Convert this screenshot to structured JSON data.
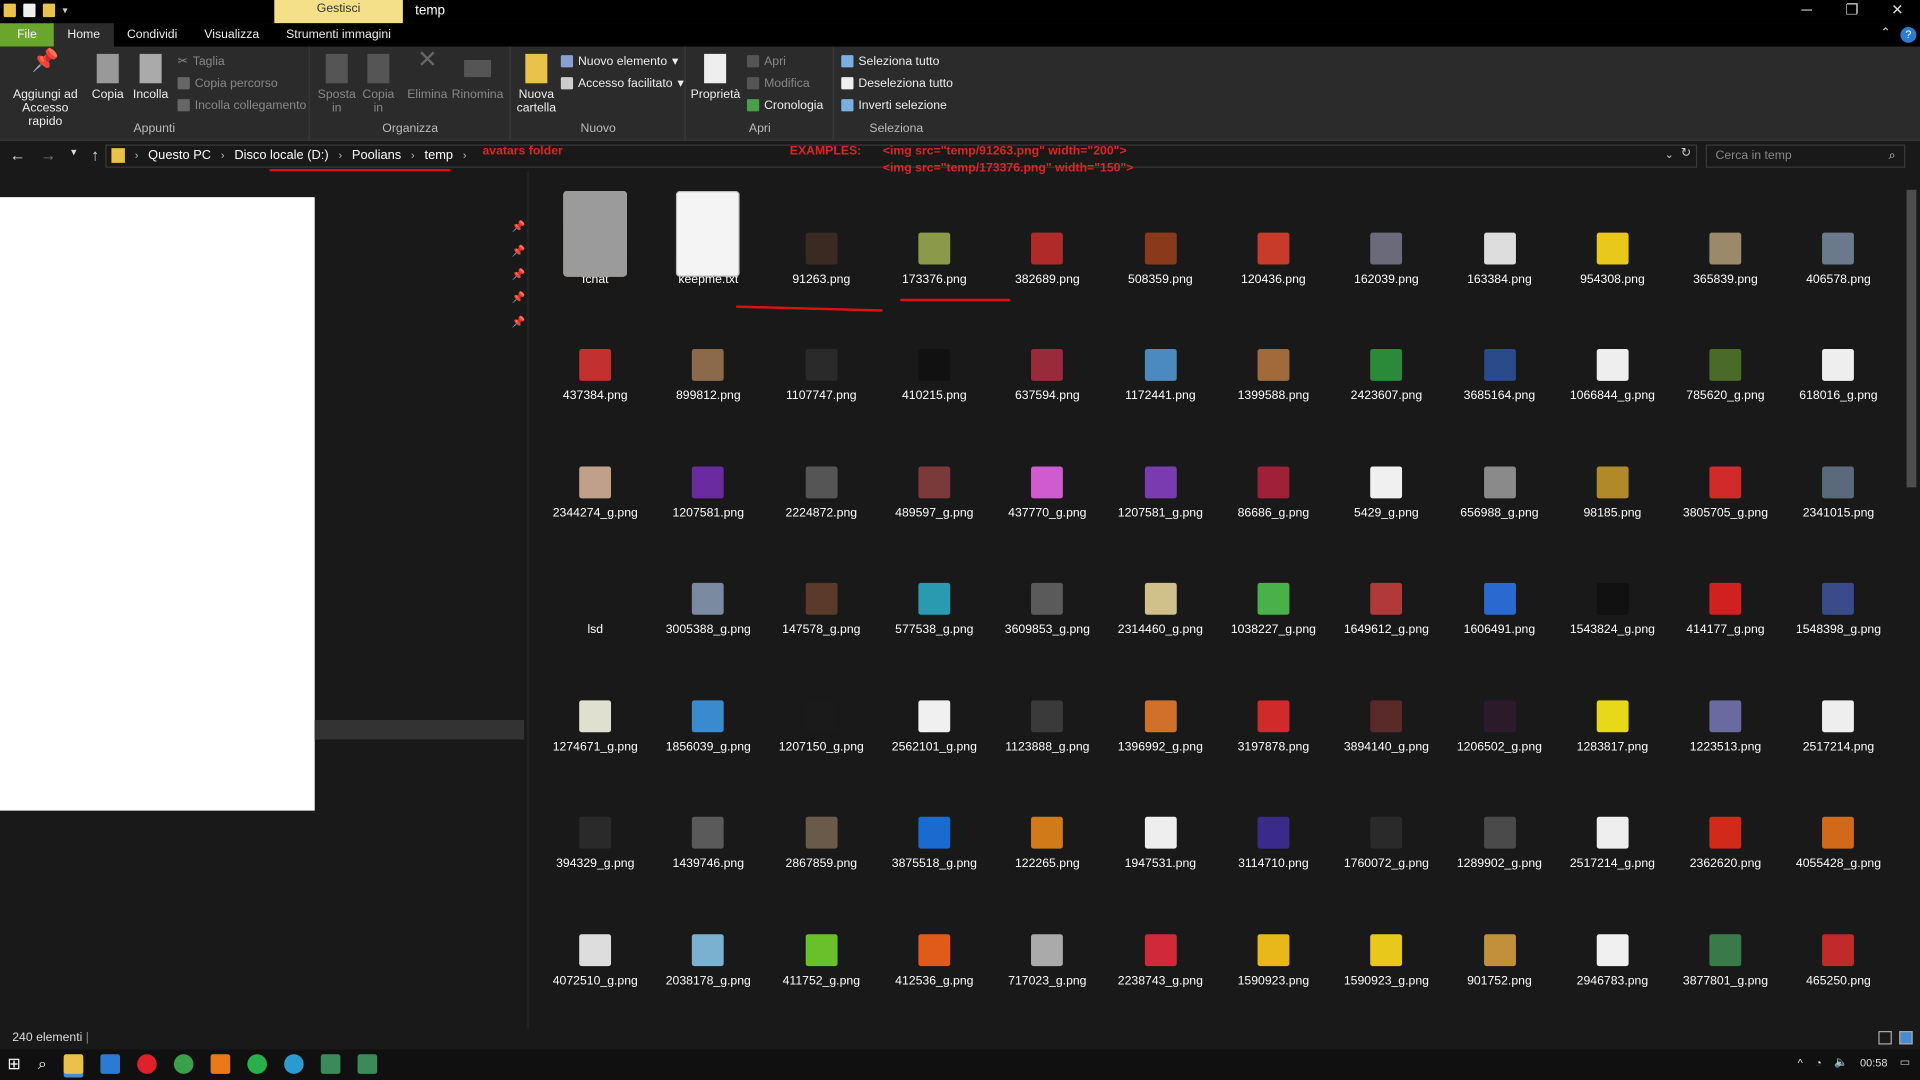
{
  "window": {
    "title": "temp",
    "context_tab": "Gestisci"
  },
  "tabs": [
    "File",
    "Home",
    "Condividi",
    "Visualizza",
    "Strumenti immagini"
  ],
  "ribbon": {
    "appunti": {
      "label": "Appunti",
      "pin": "Aggiungi ad Accesso rapido",
      "copy": "Copia",
      "paste": "Incolla",
      "cut": "Taglia",
      "copy_path": "Copia percorso",
      "paste_link": "Incolla collegamento"
    },
    "organizza": {
      "label": "Organizza",
      "move": "Sposta in",
      "copyto": "Copia in",
      "delete": "Elimina",
      "rename": "Rinomina"
    },
    "nuovo": {
      "label": "Nuovo",
      "new_folder": "Nuova cartella",
      "new_item": "Nuovo elemento",
      "easy_access": "Accesso facilitato"
    },
    "apri": {
      "label": "Apri",
      "props": "Proprietà",
      "open": "Apri",
      "edit": "Modifica",
      "history": "Cronologia"
    },
    "seleziona": {
      "label": "Seleziona",
      "all": "Seleziona tutto",
      "none": "Deseleziona tutto",
      "invert": "Inverti selezione"
    }
  },
  "address": {
    "crumbs": [
      "Questo PC",
      "Disco locale (D:)",
      "Poolians",
      "temp"
    ],
    "search_placeholder": "Cerca in temp"
  },
  "annotations": {
    "folder_note": "avatars folder",
    "examples_label": "EXAMPLES:",
    "example1": "<img src=\"temp/91263.png\" width=\"200\">",
    "example2": "<img src=\"temp/173376.png\" width=\"150\">"
  },
  "status": {
    "count": "240 elementi"
  },
  "taskbar": {
    "time": "00:58"
  },
  "files": [
    {
      "name": "fchat",
      "kind": "folder"
    },
    {
      "name": "keepme.txt",
      "kind": "txt"
    },
    {
      "name": "91263.png",
      "color": "#3a2a22"
    },
    {
      "name": "173376.png",
      "color": "#8a9a4a"
    },
    {
      "name": "382689.png",
      "color": "#b02a2a"
    },
    {
      "name": "508359.png",
      "color": "#8a3a1a"
    },
    {
      "name": "120436.png",
      "color": "#c83a2a"
    },
    {
      "name": "162039.png",
      "color": "#6a6a7a"
    },
    {
      "name": "163384.png",
      "color": "#dddddd"
    },
    {
      "name": "954308.png",
      "color": "#e8c81a"
    },
    {
      "name": "365839.png",
      "color": "#9a8a6a"
    },
    {
      "name": "406578.png",
      "color": "#6a7a8a"
    },
    {
      "name": "437384.png",
      "color": "#c23030"
    },
    {
      "name": "899812.png",
      "color": "#8a6a4a"
    },
    {
      "name": "1107747.png",
      "color": "#2a2a2a"
    },
    {
      "name": "410215.png",
      "color": "#111111"
    },
    {
      "name": "637594.png",
      "color": "#9a2a3a"
    },
    {
      "name": "1172441.png",
      "color": "#4a8ac0"
    },
    {
      "name": "1399588.png",
      "color": "#a06a3a"
    },
    {
      "name": "2423607.png",
      "color": "#2a8a3a"
    },
    {
      "name": "3685164.png",
      "color": "#2a4a8a"
    },
    {
      "name": "1066844_g.png",
      "color": "#eeeeee"
    },
    {
      "name": "785620_g.png",
      "color": "#4a6a2a"
    },
    {
      "name": "618016_g.png",
      "color": "#eeeeee"
    },
    {
      "name": "2344274_g.png",
      "color": "#c0a08a"
    },
    {
      "name": "1207581.png",
      "color": "#6a2aa0"
    },
    {
      "name": "2224872.png",
      "color": "#555555"
    },
    {
      "name": "489597_g.png",
      "color": "#7a3a3a"
    },
    {
      "name": "437770_g.png",
      "color": "#d05ad0"
    },
    {
      "name": "1207581_g.png",
      "color": "#7a3ab0"
    },
    {
      "name": "86686_g.png",
      "color": "#a0203a"
    },
    {
      "name": "5429_g.png",
      "color": "#f0f0f0"
    },
    {
      "name": "656988_g.png",
      "color": "#8a8a8a"
    },
    {
      "name": "98185.png",
      "color": "#b08a2a"
    },
    {
      "name": "3805705_g.png",
      "color": "#d02a2a"
    },
    {
      "name": "2341015.png",
      "color": "#5a6a7a"
    },
    {
      "name": "lsd",
      "kind": "file"
    },
    {
      "name": "3005388_g.png",
      "color": "#7a8aa0"
    },
    {
      "name": "147578_g.png",
      "color": "#5a3a2a"
    },
    {
      "name": "577538_g.png",
      "color": "#2a9ab0"
    },
    {
      "name": "3609853_g.png",
      "color": "#5a5a5a"
    },
    {
      "name": "2314460_g.png",
      "color": "#d0c08a"
    },
    {
      "name": "1038227_g.png",
      "color": "#4ab04a"
    },
    {
      "name": "1649612_g.png",
      "color": "#b03a3a"
    },
    {
      "name": "1606491.png",
      "color": "#2a6ad0"
    },
    {
      "name": "1543824_g.png",
      "color": "#111111"
    },
    {
      "name": "414177_g.png",
      "color": "#d02020"
    },
    {
      "name": "1548398_g.png",
      "color": "#3a4a8a"
    },
    {
      "name": "1274671_g.png",
      "color": "#e0e0d0"
    },
    {
      "name": "1856039_g.png",
      "color": "#3a8ad0"
    },
    {
      "name": "1207150_g.png",
      "color": "#1a1a1a"
    },
    {
      "name": "2562101_g.png",
      "color": "#f0f0f0"
    },
    {
      "name": "1123888_g.png",
      "color": "#3a3a3a"
    },
    {
      "name": "1396992_g.png",
      "color": "#d0702a"
    },
    {
      "name": "3197878.png",
      "color": "#d02a2a"
    },
    {
      "name": "3894140_g.png",
      "color": "#5a2a2a"
    },
    {
      "name": "1206502_g.png",
      "color": "#2a1a2a"
    },
    {
      "name": "1283817.png",
      "color": "#e8d81a"
    },
    {
      "name": "1223513.png",
      "color": "#6a6aa0"
    },
    {
      "name": "2517214.png",
      "color": "#eeeeee"
    },
    {
      "name": "394329_g.png",
      "color": "#2a2a2a"
    },
    {
      "name": "1439746.png",
      "color": "#5a5a5a"
    },
    {
      "name": "2867859.png",
      "color": "#6a5a4a"
    },
    {
      "name": "3875518_g.png",
      "color": "#1a6ad0"
    },
    {
      "name": "122265.png",
      "color": "#d07a1a"
    },
    {
      "name": "1947531.png",
      "color": "#eeeeee"
    },
    {
      "name": "3114710.png",
      "color": "#3a2a8a"
    },
    {
      "name": "1760072_g.png",
      "color": "#2a2a2a"
    },
    {
      "name": "1289902_g.png",
      "color": "#4a4a4a"
    },
    {
      "name": "2517214_g.png",
      "color": "#eeeeee"
    },
    {
      "name": "2362620.png",
      "color": "#d02a1a"
    },
    {
      "name": "4055428_g.png",
      "color": "#d06a1a"
    },
    {
      "name": "4072510_g.png",
      "color": "#dddddd"
    },
    {
      "name": "2038178_g.png",
      "color": "#7ab0d0"
    },
    {
      "name": "411752_g.png",
      "color": "#6ac02a"
    },
    {
      "name": "412536_g.png",
      "color": "#e05a1a"
    },
    {
      "name": "717023_g.png",
      "color": "#aaaaaa"
    },
    {
      "name": "2238743_g.png",
      "color": "#d02a3a"
    },
    {
      "name": "1590923.png",
      "color": "#e8b81a"
    },
    {
      "name": "1590923_g.png",
      "color": "#e8c81a"
    },
    {
      "name": "901752.png",
      "color": "#c0903a"
    },
    {
      "name": "2946783.png",
      "color": "#f0f0f0"
    },
    {
      "name": "3877801_g.png",
      "color": "#3a7a4a"
    },
    {
      "name": "465250.png",
      "color": "#c02a2a"
    }
  ]
}
